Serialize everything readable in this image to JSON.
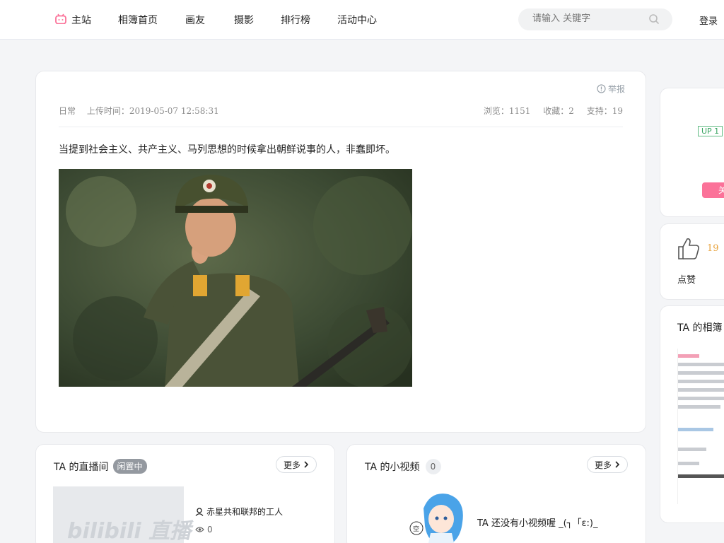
{
  "nav": {
    "items": [
      {
        "label": "主站",
        "active": true
      },
      {
        "label": "相簿首页"
      },
      {
        "label": "画友"
      },
      {
        "label": "摄影"
      },
      {
        "label": "排行榜"
      },
      {
        "label": "活动中心"
      }
    ],
    "search_placeholder": "请输入 关键字",
    "login_label": "登录",
    "brand_color": "#fb7299"
  },
  "post": {
    "report_label": "举报",
    "category": "日常",
    "upload_time": "上传时间：2019-05-07 12:58:31",
    "views": "浏览：1151",
    "favorites": "收藏：2",
    "supports": "支持：19",
    "description": "当提到社会主义、共产主义、马列思想的时候拿出朝鲜说事的人，非蠢即坏。"
  },
  "live": {
    "title": "TA 的直播间",
    "status": "闲置中",
    "more_label": "更多",
    "thumb_text": "bilibili 直播",
    "owner": "赤星共和联邦的工人",
    "views": "0"
  },
  "videos": {
    "title": "TA 的小视频",
    "count": "0",
    "more_label": "更多",
    "empty_text": "TA 还没有小视频喔 _(┐「ε:)_"
  },
  "side": {
    "up_badge": "UP 1",
    "follow_label": "关",
    "like_count": "19",
    "like_label": "点赞",
    "album_title": "TA 的相簿"
  }
}
